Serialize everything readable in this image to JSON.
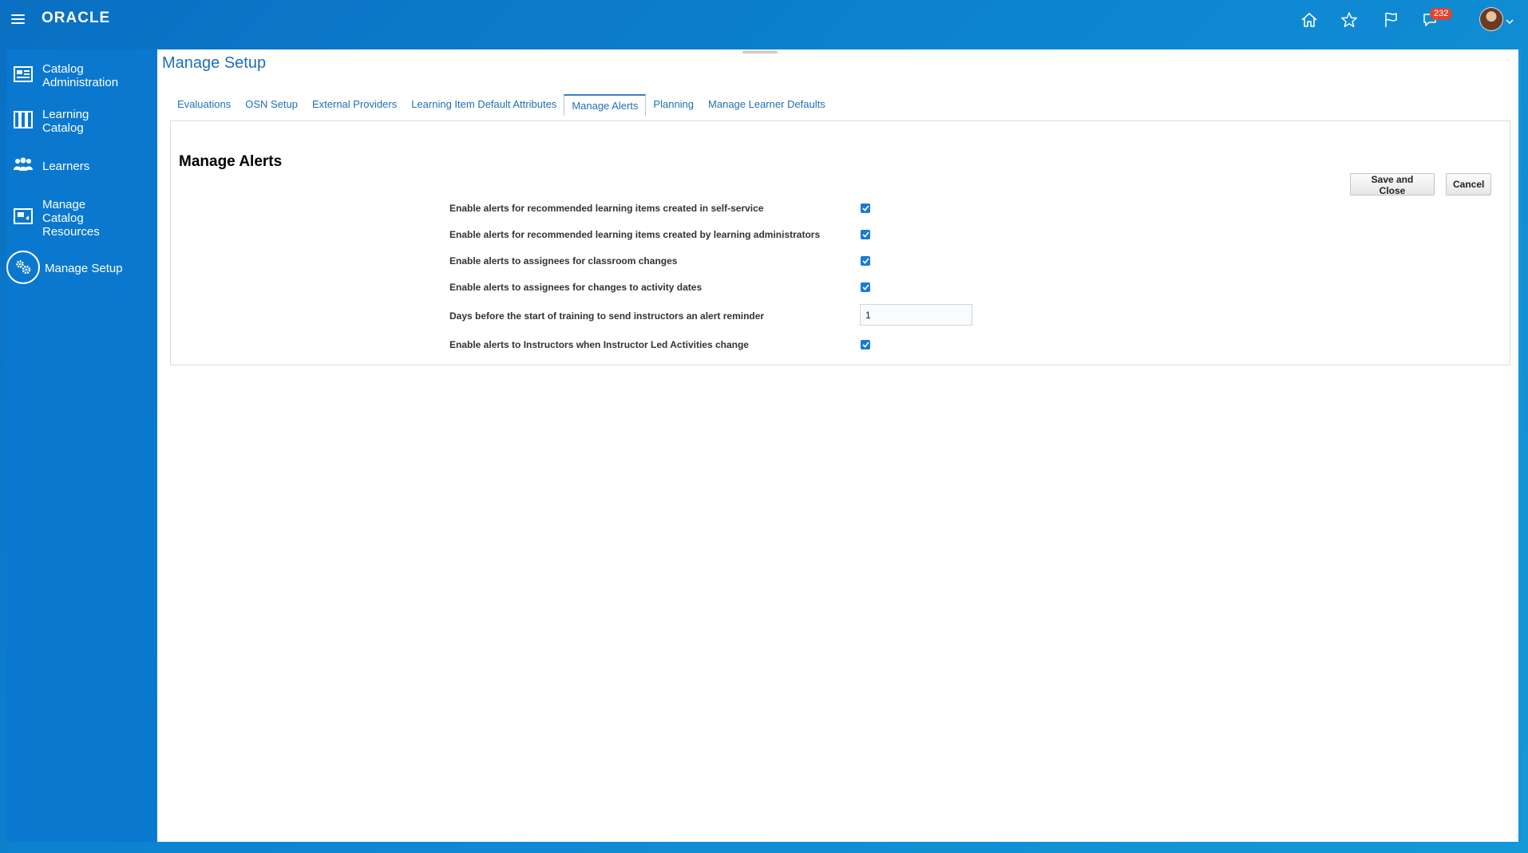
{
  "brand": {
    "logo_text": "ORACLE"
  },
  "topbar": {
    "icons": [
      "home-icon",
      "star-icon",
      "flag-icon",
      "notifications-icon"
    ],
    "notification_count": "232"
  },
  "sidebar": {
    "items": [
      {
        "label_line1": "Catalog",
        "label_line2": "Administration",
        "label_line3": "",
        "icon": "catalog-admin-icon"
      },
      {
        "label_line1": "Learning",
        "label_line2": "Catalog",
        "label_line3": "",
        "icon": "learning-catalog-icon"
      },
      {
        "label_line1": "Learners",
        "label_line2": "",
        "label_line3": "",
        "icon": "learners-icon"
      },
      {
        "label_line1": "Manage",
        "label_line2": "Catalog",
        "label_line3": "Resources",
        "icon": "catalog-resources-icon"
      },
      {
        "label_line1": "Manage Setup",
        "label_line2": "",
        "label_line3": "",
        "icon": "gears-icon"
      }
    ],
    "active_index": 4
  },
  "page": {
    "title": "Manage Setup"
  },
  "tabs": [
    {
      "label": "Evaluations"
    },
    {
      "label": "OSN Setup"
    },
    {
      "label": "External Providers"
    },
    {
      "label": "Learning Item Default Attributes"
    },
    {
      "label": "Manage Alerts"
    },
    {
      "label": "Planning"
    },
    {
      "label": "Manage Learner Defaults"
    }
  ],
  "active_tab": "Manage Alerts",
  "section": {
    "title": "Manage Alerts",
    "save_label": "Save and Close",
    "cancel_label": "Cancel"
  },
  "form": {
    "rows": [
      {
        "label": "Enable alerts for recommended learning items created in self-service",
        "type": "checkbox",
        "checked": true
      },
      {
        "label": "Enable alerts for recommended learning items created by learning administrators",
        "type": "checkbox",
        "checked": true
      },
      {
        "label": "Enable alerts to assignees for classroom changes",
        "type": "checkbox",
        "checked": true
      },
      {
        "label": "Enable alerts to assignees for changes to activity dates",
        "type": "checkbox",
        "checked": true
      },
      {
        "label": "Days before the start of training to send instructors an alert reminder",
        "type": "text",
        "value": "1"
      },
      {
        "label": "Enable alerts to Instructors when Instructor Led Activities change",
        "type": "checkbox",
        "checked": true
      }
    ]
  },
  "colors": {
    "accent": "#1f6fb4",
    "sidebar": "#0b78cf",
    "checkbox": "#1b7bd2",
    "badge": "#e0452f"
  }
}
